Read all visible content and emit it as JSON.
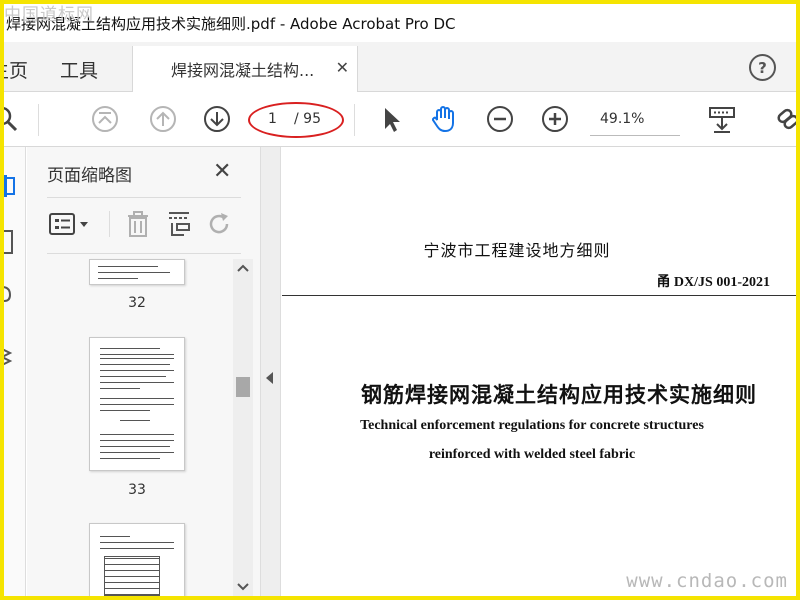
{
  "window": {
    "title": "焊接网混凝土结构应用技术实施细则.pdf - Adobe Acrobat Pro DC",
    "watermark_top": "中国道标网"
  },
  "tabs": {
    "home": "主页",
    "tools": "工具",
    "document": "焊接网混凝土结构...",
    "help": "?"
  },
  "toolbar": {
    "current_page": "1",
    "total_pages": "/ 95",
    "zoom": "49.1%"
  },
  "thumbnails": {
    "title": "页面缩略图",
    "items": [
      {
        "page": "32"
      },
      {
        "page": "33"
      }
    ]
  },
  "document": {
    "heading": "宁波市工程建设地方细则",
    "code": "甬 DX/JS  001-2021",
    "title": "钢筋焊接网混凝土结构应用技术实施细则",
    "english_line1": "Technical enforcement regulations for concrete structures",
    "english_line2": "reinforced with welded steel fabric"
  },
  "watermark_bottom": "www.cndao.com",
  "colors": {
    "border": "#f5e400",
    "highlight_oval": "#d92020",
    "accent": "#1473e6"
  }
}
